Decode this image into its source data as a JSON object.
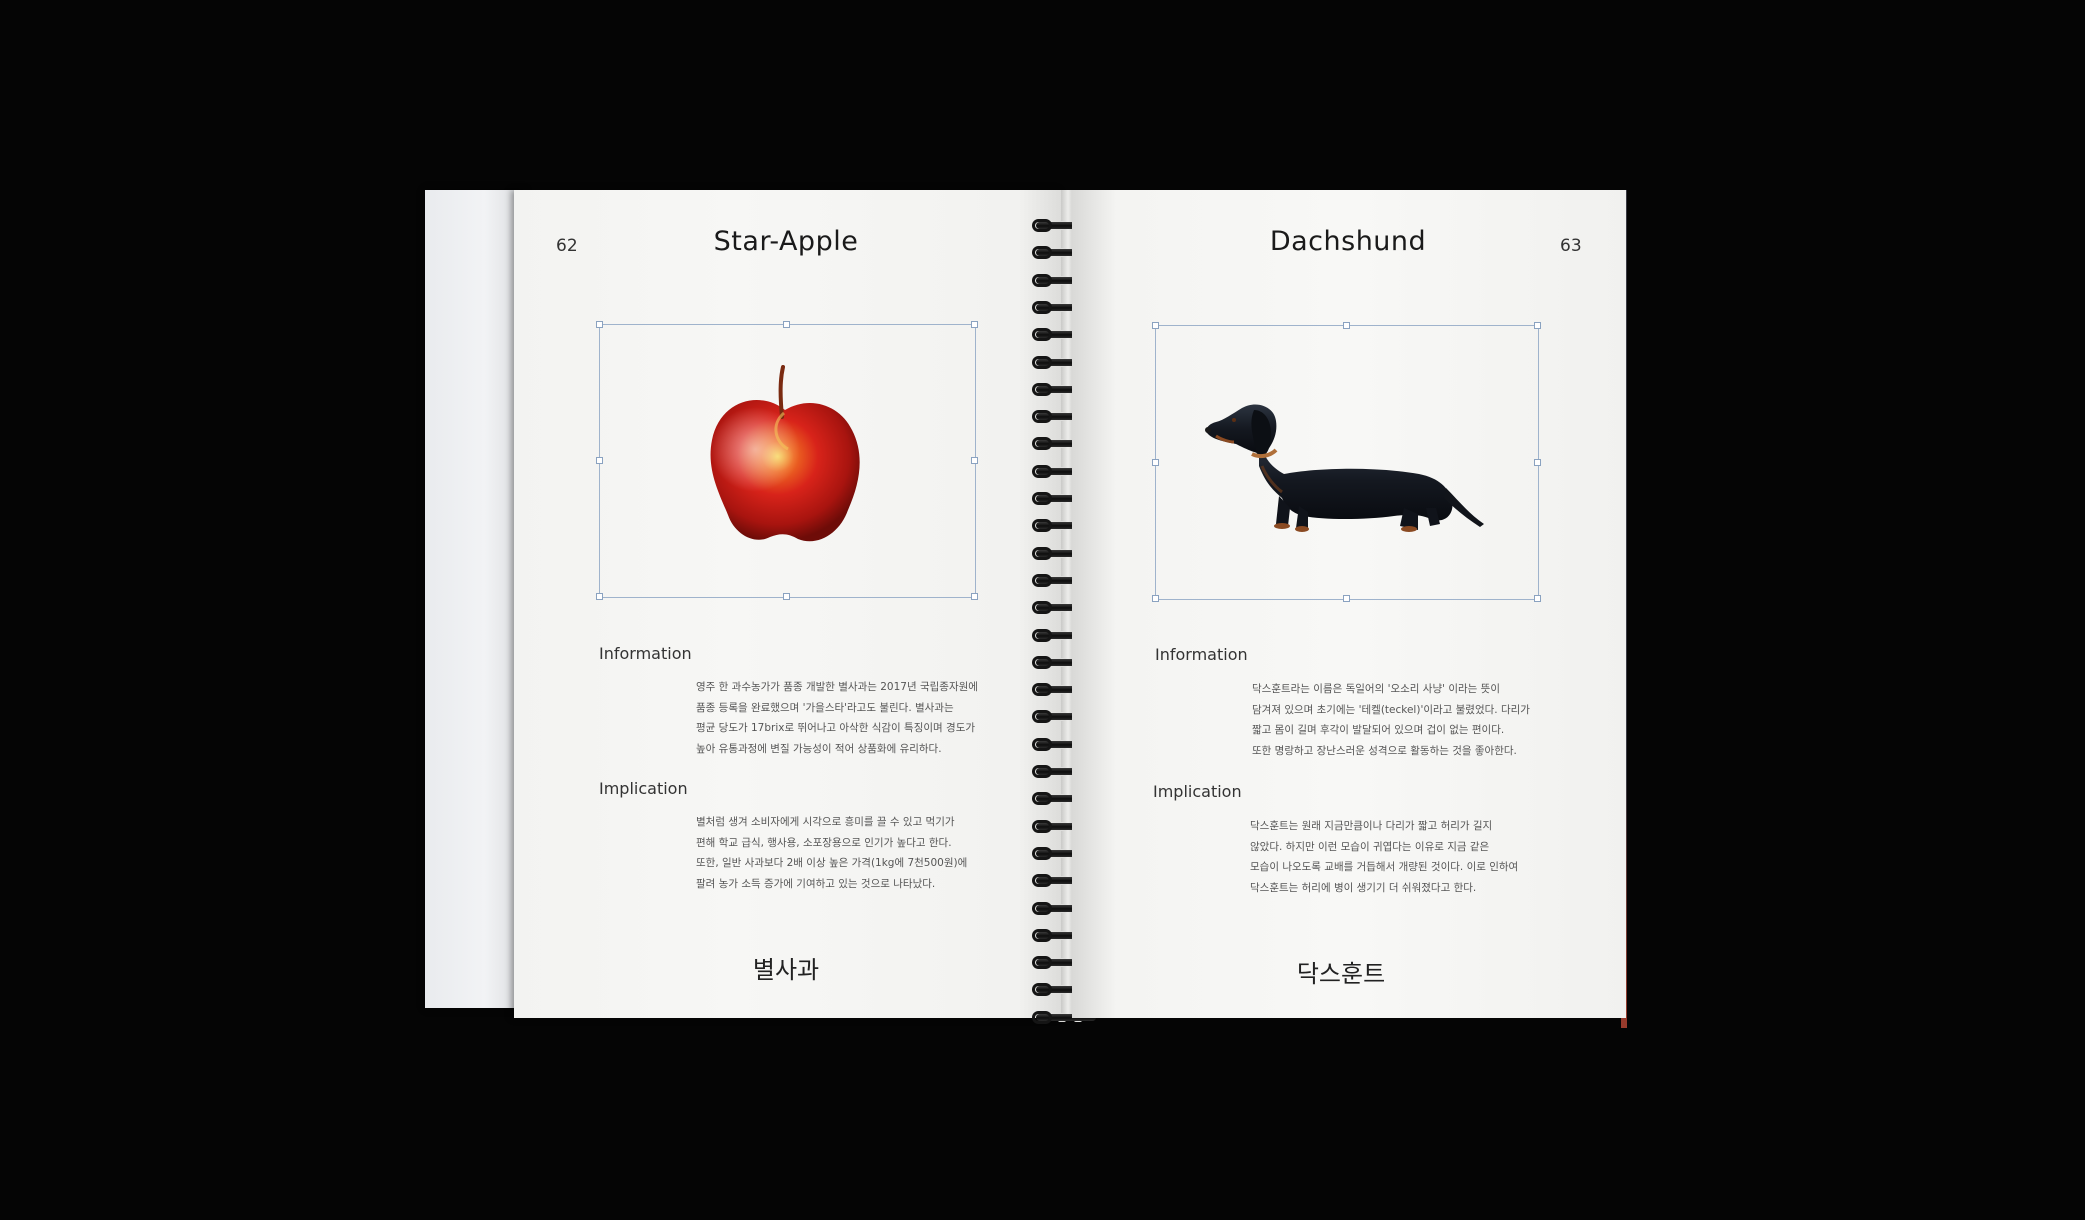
{
  "left_page": {
    "page_number": "62",
    "title": "Star-Apple",
    "image_icon": "red-apple-photo",
    "information_heading": "Information",
    "information_lines": [
      "영주 한 과수농가가 품종 개발한 별사과는 2017년 국립종자원에",
      "품종 등록을 완료했으며 '가을스타'라고도 불린다. 별사과는",
      "평균 당도가 17brix로 뛰어나고 아삭한 식감이 특징이며 경도가",
      "높아 유통과정에 변질 가능성이 적어 상품화에 유리하다."
    ],
    "implication_heading": "Implication",
    "implication_lines": [
      "별처럼 생겨 소비자에게 시각으로 흥미를 끌 수 있고 먹기가",
      "편해 학교 급식, 행사용, 소포장용으로 인기가 높다고 한다.",
      "또한, 일반 사과보다 2배 이상 높은 가격(1kg에 7천500원)에",
      "팔려 농가 소득 증가에 기여하고 있는 것으로 나타났다."
    ],
    "korean_title": "별사과"
  },
  "right_page": {
    "page_number": "63",
    "title": "Dachshund",
    "image_icon": "dachshund-dog-photo",
    "information_heading": "Information",
    "information_lines": [
      "닥스훈트라는 이름은 독일어의 '오소리 사냥' 이라는 뜻이",
      "담겨져 있으며 초기에는 '테켈(teckel)'이라고 불렸었다. 다리가",
      "짧고 몸이 길며 후각이 발달되어 있으며 겁이 없는 편이다.",
      "또한 명랑하고 장난스러운 성격으로 활동하는 것을 좋아한다."
    ],
    "implication_heading": "Implication",
    "implication_lines": [
      "닥스훈트는 원래 지금만큼이나 다리가 짧고 허리가 길지",
      "않았다. 하지만 이런 모습이 귀엽다는 이유로 지금 같은",
      "모습이 나오도록 교배를 거듭해서 개량된 것이다. 이로 인하여",
      "닥스훈트는 허리에 병이 생기기 더 쉬워졌다고 한다."
    ],
    "korean_title": "닥스훈트"
  },
  "colors": {
    "background": "#050505",
    "page": "#f6f6f4",
    "frame": "#9fb3cc",
    "apple_red": "#d0231b",
    "dog_black": "#141820"
  }
}
